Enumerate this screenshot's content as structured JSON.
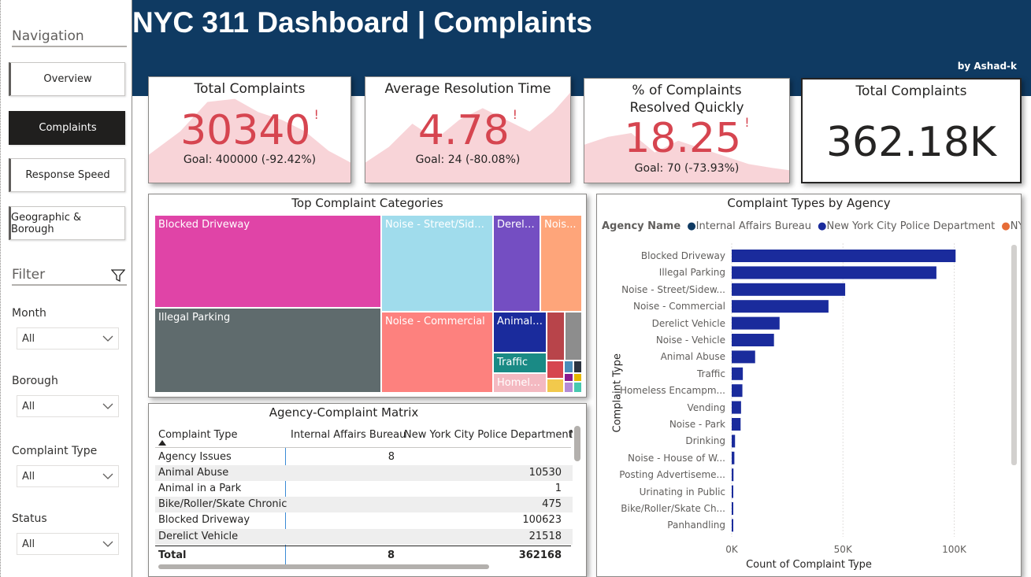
{
  "header": {
    "title": "NYC 311 Dashboard | Complaints",
    "byline": "by Ashad-k"
  },
  "sidebar": {
    "nav_title": "Navigation",
    "nav_items": [
      {
        "label": "Overview",
        "active": false
      },
      {
        "label": "Complaints",
        "active": true
      },
      {
        "label": "Response Speed",
        "active": false
      },
      {
        "label": "Geographic & Borough",
        "active": false
      }
    ],
    "filter_title": "Filter",
    "slicers": [
      {
        "label": "Month",
        "value": "All"
      },
      {
        "label": "Borough",
        "value": "All"
      },
      {
        "label": "Complaint Type",
        "value": "All"
      },
      {
        "label": "Status",
        "value": "All"
      }
    ]
  },
  "kpis": [
    {
      "title": "Total Complaints",
      "value": "30340",
      "flag": "!",
      "goal": "Goal: 400000 (-92.42%)"
    },
    {
      "title": "Average Resolution Time",
      "value": "4.78",
      "flag": "!",
      "goal": "Goal: 24 (-80.08%)"
    },
    {
      "title": "% of Complaints Resolved Quickly",
      "value": "18.25",
      "flag": "!",
      "goal": "Goal: 70 (-73.93%)"
    },
    {
      "title": "Total Complaints",
      "value": "362.18K"
    }
  ],
  "treemap": {
    "title": "Top Complaint Categories",
    "tiles": [
      {
        "label": "Blocked Driveway",
        "color": "#e044a7"
      },
      {
        "label": "Illegal Parking",
        "color": "#5f6b6d"
      },
      {
        "label": "Noise - Street/Side...",
        "color": "#a0dcec"
      },
      {
        "label": "Noise - Commercial",
        "color": "#fd817e"
      },
      {
        "label": "Dereli...",
        "color": "#744ec2"
      },
      {
        "label": "Nois...",
        "color": "#fea57a"
      },
      {
        "label": "Animal ...",
        "color": "#1a2b9c"
      },
      {
        "label": "Traffic",
        "color": "#1a8a85"
      },
      {
        "label": "Homele...",
        "color": "#f4b9c1"
      }
    ]
  },
  "matrix": {
    "title": "Agency-Complaint Matrix",
    "columns": [
      "Complaint Type",
      "Internal Affairs Bureau",
      "New York City Police Department",
      "N"
    ],
    "rows": [
      {
        "type": "Agency Issues",
        "iab": "8",
        "nypd": ""
      },
      {
        "type": "Animal Abuse",
        "iab": "",
        "nypd": "10530"
      },
      {
        "type": "Animal in a Park",
        "iab": "",
        "nypd": "1"
      },
      {
        "type": "Bike/Roller/Skate Chronic",
        "iab": "",
        "nypd": "475"
      },
      {
        "type": "Blocked Driveway",
        "iab": "",
        "nypd": "100623"
      },
      {
        "type": "Derelict Vehicle",
        "iab": "",
        "nypd": "21518"
      }
    ],
    "total": {
      "label": "Total",
      "iab": "8",
      "nypd": "362168"
    }
  },
  "chart_data": {
    "type": "bar",
    "orientation": "horizontal",
    "title": "Complaint Types by Agency",
    "legend_title": "Agency Name",
    "legend": [
      {
        "name": "Internal Affairs Bureau",
        "color": "#0f3a62"
      },
      {
        "name": "New York City Police Department",
        "color": "#1a2b9c"
      },
      {
        "name": "NYPD",
        "color": "#e66c37"
      }
    ],
    "categories": [
      "Blocked Driveway",
      "Illegal Parking",
      "Noise - Street/Sidew...",
      "Noise - Commercial",
      "Derelict Vehicle",
      "Noise - Vehicle",
      "Animal Abuse",
      "Traffic",
      "Homeless Encampm...",
      "Vending",
      "Noise - Park",
      "Drinking",
      "Noise - House of W...",
      "Posting Advertiseme...",
      "Urinating in Public",
      "Bike/Roller/Skate Ch...",
      "Panhandling"
    ],
    "values": [
      100623,
      92000,
      51000,
      43500,
      21518,
      19000,
      10530,
      5000,
      4800,
      4200,
      4000,
      1500,
      1200,
      800,
      700,
      475,
      300
    ],
    "xlabel": "Count of Complaint Type",
    "ylabel": "Complaint Type",
    "xlim": [
      0,
      120000
    ],
    "xticks": [
      "0K",
      "50K",
      "100K"
    ],
    "xtick_values": [
      0,
      50000,
      100000
    ]
  }
}
